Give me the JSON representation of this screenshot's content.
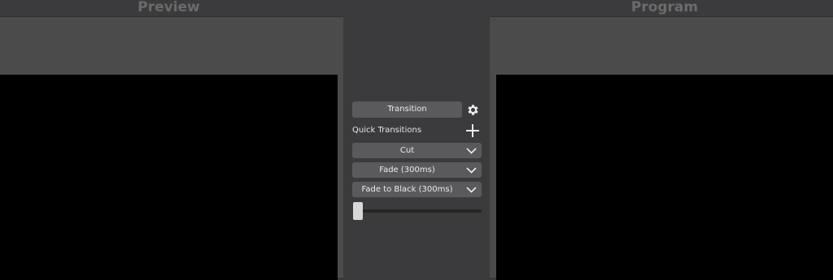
{
  "preview": {
    "title": "Preview"
  },
  "program": {
    "title": "Program"
  },
  "transition_panel": {
    "transition_button_label": "Transition",
    "settings_icon": "gear-icon",
    "quick_transitions_label": "Quick Transitions",
    "add_icon": "plus-icon",
    "quick_transitions": [
      {
        "label": "Cut",
        "icon": "chevron-down-icon"
      },
      {
        "label": "Fade (300ms)",
        "icon": "chevron-down-icon"
      },
      {
        "label": "Fade to Black (300ms)",
        "icon": "chevron-down-icon"
      }
    ],
    "slider_value": 0
  },
  "colors": {
    "background": "#3b3a3c",
    "pane": "#4b4b4b",
    "button": "#5a595b",
    "title_text": "#6b6b6b",
    "video": "#000000"
  }
}
